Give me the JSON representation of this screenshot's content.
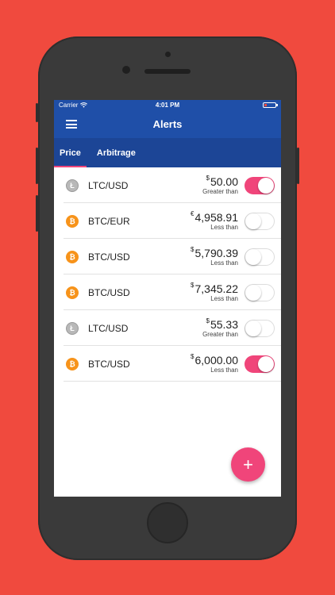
{
  "status_bar": {
    "carrier": "Carrier",
    "time": "4:01 PM"
  },
  "app_bar": {
    "title": "Alerts",
    "menu_icon": "hamburger-menu-icon"
  },
  "tabs": [
    {
      "label": "Price",
      "active": true
    },
    {
      "label": "Arbitrage",
      "active": false
    }
  ],
  "alerts": [
    {
      "coin": "ltc",
      "coin_glyph": "Ł",
      "pair": "LTC/USD",
      "currency": "$",
      "amount": "50.00",
      "condition": "Greater than",
      "enabled": true
    },
    {
      "coin": "btc",
      "coin_glyph": "₿",
      "pair": "BTC/EUR",
      "currency": "€",
      "amount": "4,958.91",
      "condition": "Less than",
      "enabled": false
    },
    {
      "coin": "btc",
      "coin_glyph": "₿",
      "pair": "BTC/USD",
      "currency": "$",
      "amount": "5,790.39",
      "condition": "Less than",
      "enabled": false
    },
    {
      "coin": "btc",
      "coin_glyph": "₿",
      "pair": "BTC/USD",
      "currency": "$",
      "amount": "7,345.22",
      "condition": "Less than",
      "enabled": false
    },
    {
      "coin": "ltc",
      "coin_glyph": "Ł",
      "pair": "LTC/USD",
      "currency": "$",
      "amount": "55.33",
      "condition": "Greater than",
      "enabled": false
    },
    {
      "coin": "btc",
      "coin_glyph": "₿",
      "pair": "BTC/USD",
      "currency": "$",
      "amount": "6,000.00",
      "condition": "Less than",
      "enabled": true
    }
  ],
  "fab": {
    "label": "+"
  },
  "colors": {
    "background": "#f04a3e",
    "app_bar": "#1f4fa8",
    "accent": "#f0457a",
    "btc": "#f7931a",
    "ltc": "#b8b8b8"
  }
}
